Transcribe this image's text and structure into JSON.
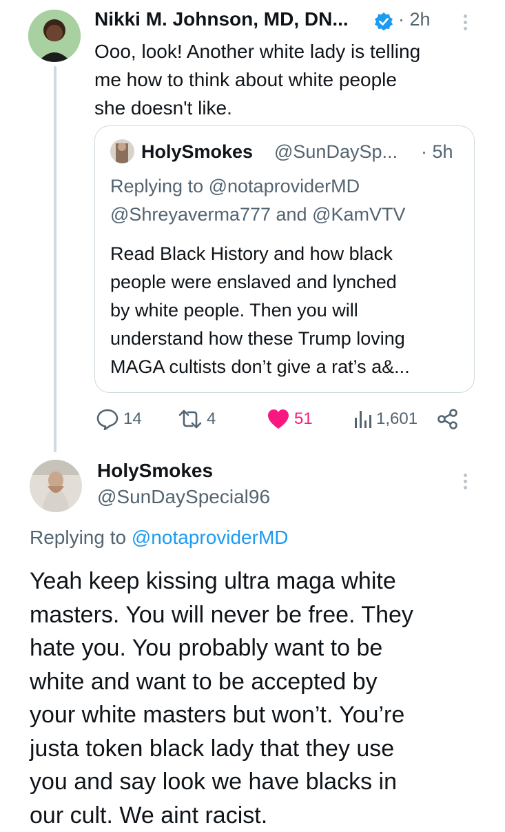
{
  "main_tweet": {
    "author_name": "Nikki M. Johnson, MD, DN...",
    "time": "· 2h",
    "text_lines": [
      "Ooo, look! Another white lady is telling",
      "me how to think about white people",
      "she doesn't like."
    ]
  },
  "quoted_tweet": {
    "author_name": "HolySmokes",
    "handle": "@SunDaySp...",
    "time": "· 5h",
    "replying_label": "Replying to",
    "replying_to": "@notaproviderMD",
    "replying_line2": "@Shreyaverma777 and @KamVTV",
    "text_lines": [
      "Read Black History and how black",
      "people were enslaved and lynched",
      "by white people. Then you will",
      "understand how these Trump loving",
      "MAGA cultists don’t give a rat’s a&..."
    ]
  },
  "actions": {
    "replies": "14",
    "retweets": "4",
    "likes": "51",
    "views": "1,601"
  },
  "reply_tweet": {
    "author_name": "HolySmokes",
    "handle": "@SunDaySpecial96",
    "replying_label": "Replying to",
    "replying_to": "@notaproviderMD",
    "text_lines": [
      "Yeah keep kissing ultra maga white",
      "masters. You will never be free. They",
      "hate you. You probably want to be",
      "white and want to be accepted by",
      "your white masters but won’t. You’re",
      "justa token black lady that they use",
      "you and say look we have blacks in",
      "our cult. We aint racist."
    ]
  },
  "colors": {
    "accent": "#1d9bf0",
    "like": "#f91880",
    "muted": "#536471"
  },
  "icons": [
    "verified-badge-icon",
    "more-icon",
    "reply-icon",
    "retweet-icon",
    "heart-icon",
    "views-icon",
    "share-icon"
  ]
}
